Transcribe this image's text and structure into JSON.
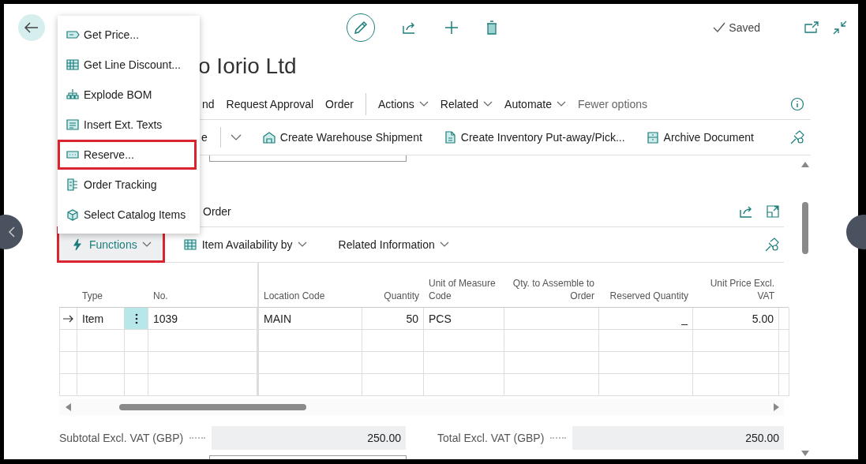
{
  "header": {
    "status": "Saved"
  },
  "title": "o Iorio Ltd",
  "action_bar": {
    "actions": [
      "nd",
      "Request Approval",
      "Order"
    ],
    "menus": [
      "Actions",
      "Related",
      "Automate"
    ],
    "toggle": "Fewer options"
  },
  "promoted_bar": {
    "split_button": "e",
    "actions": [
      "Create Warehouse Shipment",
      "Create Inventory Put-away/Pick...",
      "Archive Document"
    ]
  },
  "menu": {
    "items": [
      {
        "label": "Get Price...",
        "annotated": false
      },
      {
        "label": "Get Line Discount...",
        "annotated": false
      },
      {
        "label": "Explode BOM",
        "annotated": false
      },
      {
        "label": "Insert Ext. Texts",
        "annotated": false
      },
      {
        "label": "Reserve...",
        "annotated": true
      },
      {
        "label": "Order Tracking",
        "annotated": false
      },
      {
        "label": "Select Catalog Items",
        "annotated": false
      }
    ]
  },
  "lines": {
    "title": "Order",
    "toolbar": [
      {
        "label": "Functions",
        "selected": true,
        "annotated": true
      },
      {
        "label": "Item Availability by",
        "selected": false,
        "annotated": false
      },
      {
        "label": "Related Information",
        "selected": false,
        "annotated": false
      }
    ],
    "columns": [
      {
        "label": "Type",
        "numeric": false
      },
      {
        "label": "No.",
        "numeric": false
      },
      {
        "label": "Location Code",
        "numeric": false
      },
      {
        "label": "Quantity",
        "numeric": true
      },
      {
        "label": "Unit of Measure Code",
        "numeric": false
      },
      {
        "label": "Qty. to Assemble to Order",
        "numeric": true
      },
      {
        "label": "Reserved Quantity",
        "numeric": true
      },
      {
        "label": "Unit Price Excl. VAT",
        "numeric": true
      }
    ],
    "rows": [
      {
        "current": true,
        "cells": [
          "Item",
          "1039",
          "MAIN",
          "50",
          "PCS",
          null,
          "_",
          "5.00"
        ]
      },
      {
        "current": false
      },
      {
        "current": false
      },
      {
        "current": false
      }
    ]
  },
  "totals": [
    {
      "label": "Subtotal Excl. VAT (GBP)",
      "value": "250.00"
    },
    {
      "label": "Total Excl. VAT (GBP)",
      "value": "250.00"
    }
  ]
}
